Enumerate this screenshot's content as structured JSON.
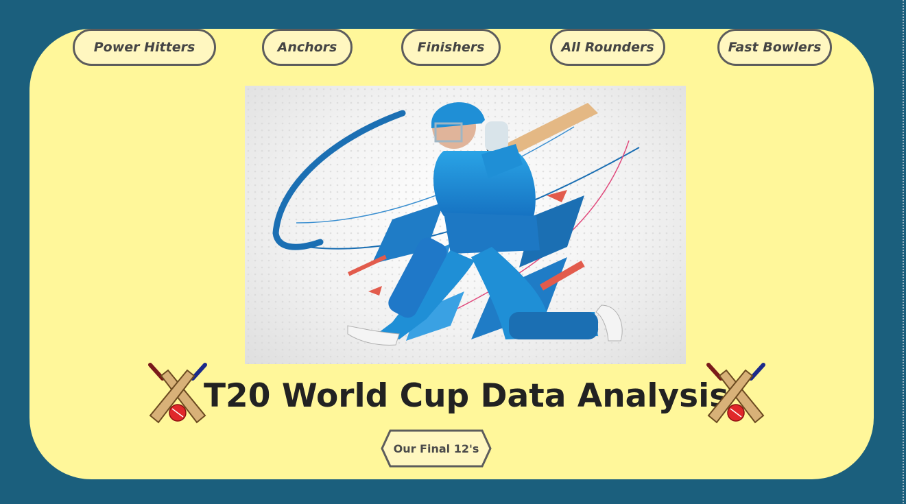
{
  "nav": {
    "items": [
      {
        "label": "Power Hitters"
      },
      {
        "label": "Anchors"
      },
      {
        "label": "Finishers"
      },
      {
        "label": "All Rounders"
      },
      {
        "label": "Fast Bowlers"
      }
    ]
  },
  "hero": {
    "icon": "cricket-batsman-illustration"
  },
  "title": {
    "text": "T20 World Cup Data Analysis",
    "left_icon": "crossed-cricket-bats-icon",
    "right_icon": "crossed-cricket-bats-icon"
  },
  "cta": {
    "label": "Our Final 12's"
  },
  "colors": {
    "background": "#1b5f7d",
    "card": "#fff79a",
    "button_fill": "#fff7c0",
    "button_border": "#5c5c5c",
    "title_text": "#222222",
    "player_blue": "#1f8fd6"
  }
}
